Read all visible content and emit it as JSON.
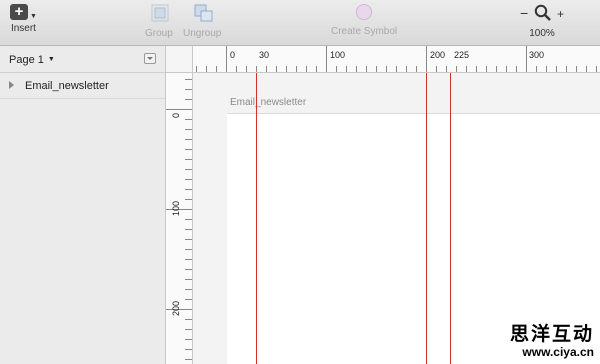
{
  "toolbar": {
    "insert": {
      "label": "Insert",
      "icon": "plus-icon"
    },
    "group": {
      "label": "Group",
      "icon": "group-icon",
      "enabled": false
    },
    "ungroup": {
      "label": "Ungroup",
      "icon": "ungroup-icon",
      "enabled": false
    },
    "create_symbol": {
      "label": "Create Symbol",
      "icon": "symbol-icon",
      "enabled": false
    },
    "zoom": {
      "minus": "−",
      "plus": "+",
      "level": "100%"
    }
  },
  "sidebar": {
    "page_selector": "Page 1",
    "layers": [
      {
        "name": "Email_newsletter",
        "expanded": false
      }
    ]
  },
  "rulers": {
    "horizontal_labels": [
      "0",
      "30",
      "100",
      "200",
      "225",
      "300"
    ],
    "vertical_labels": [
      "0",
      "100",
      "200"
    ]
  },
  "canvas": {
    "artboard_title": "Email_newsletter",
    "guide_color": "#d0312d"
  },
  "watermark": {
    "chinese": "思洋互动",
    "url": "www.ciya.cn"
  }
}
